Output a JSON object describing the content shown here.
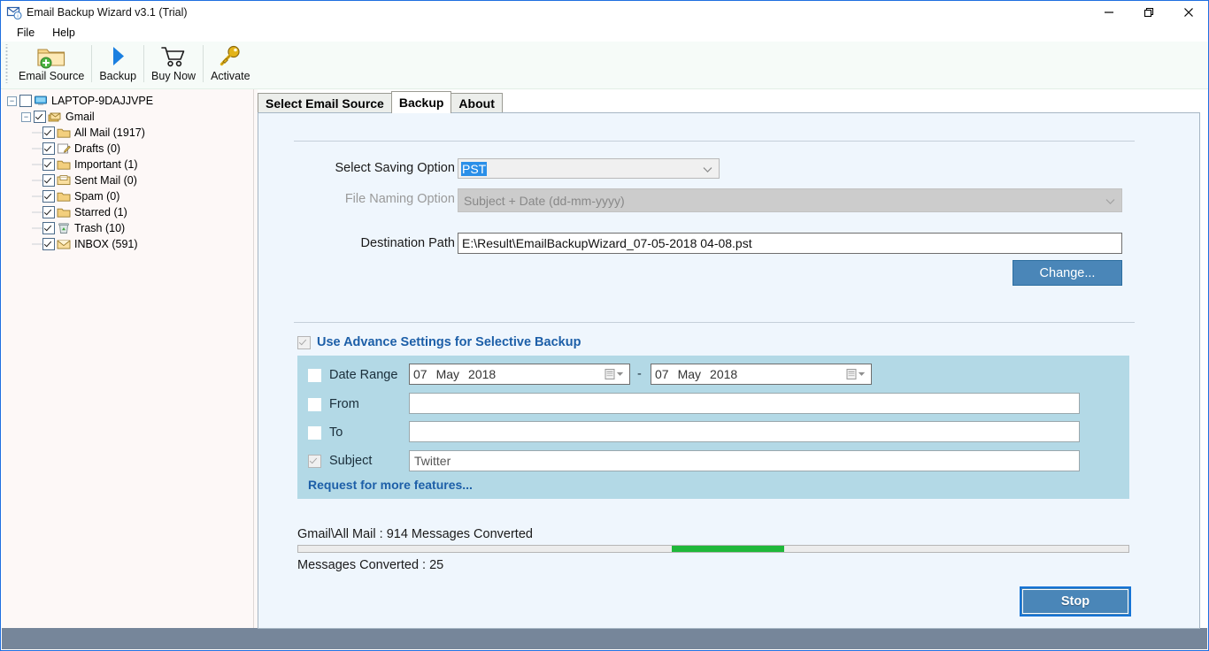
{
  "window": {
    "title": "Email Backup Wizard v3.1 (Trial)",
    "icon": "mail-backup-icon",
    "controls": [
      {
        "name": "minimize-button",
        "glyph": "minimize-icon"
      },
      {
        "name": "maximize-button",
        "glyph": "maximize-icon"
      },
      {
        "name": "close-button",
        "glyph": "close-icon"
      }
    ]
  },
  "menubar": {
    "items": [
      {
        "label": "File",
        "name": "menu-file"
      },
      {
        "label": "Help",
        "name": "menu-help"
      }
    ]
  },
  "toolbar": {
    "buttons": [
      {
        "label": "Email Source",
        "icon": "folder-add-icon",
        "name": "toolbar-email-source"
      },
      {
        "label": "Backup",
        "icon": "play-triangle-icon",
        "name": "toolbar-backup"
      },
      {
        "label": "Buy Now",
        "icon": "shopping-cart-icon",
        "name": "toolbar-buy-now"
      },
      {
        "label": "Activate",
        "icon": "key-icon",
        "name": "toolbar-activate"
      }
    ]
  },
  "tree": {
    "root": {
      "label": "LAPTOP-9DAJJVPE",
      "icon": "computer-icon",
      "checked": false,
      "expanded": true
    },
    "account": {
      "label": "Gmail",
      "icon": "mail-stack-icon",
      "checked": true,
      "expanded": true
    },
    "folders": [
      {
        "label": "All Mail (1917)",
        "icon": "folder-icon",
        "checked": true
      },
      {
        "label": "Drafts (0)",
        "icon": "drafts-icon",
        "checked": true
      },
      {
        "label": "Important (1)",
        "icon": "folder-icon",
        "checked": true
      },
      {
        "label": "Sent Mail (0)",
        "icon": "sent-icon",
        "checked": true
      },
      {
        "label": "Spam (0)",
        "icon": "folder-icon",
        "checked": true
      },
      {
        "label": "Starred (1)",
        "icon": "folder-icon",
        "checked": true
      },
      {
        "label": "Trash (10)",
        "icon": "trash-icon",
        "checked": true
      },
      {
        "label": "INBOX (591)",
        "icon": "inbox-icon",
        "checked": true
      }
    ]
  },
  "tabs": [
    {
      "label": "Select Email Source",
      "name": "tab-select-email-source",
      "active": false
    },
    {
      "label": "Backup",
      "name": "tab-backup",
      "active": true
    },
    {
      "label": "About",
      "name": "tab-about",
      "active": false
    }
  ],
  "form": {
    "saving_option_label": "Select Saving Option :",
    "saving_option_value": "PST",
    "file_naming_label": "File Naming Option :",
    "file_naming_value": "Subject + Date (dd-mm-yyyy)",
    "destination_label": "Destination Path :",
    "destination_value": "E:\\Result\\EmailBackupWizard_07-05-2018 04-08.pst",
    "change_button": "Change..."
  },
  "advance": {
    "title": "Use Advance Settings for Selective Backup",
    "title_checked": true,
    "date_range_label": "Date Range",
    "date_range_checked": false,
    "date_from": {
      "day": "07",
      "month": "May",
      "year": "2018"
    },
    "date_separator": "-",
    "date_to": {
      "day": "07",
      "month": "May",
      "year": "2018"
    },
    "from_label": "From",
    "from_checked": false,
    "from_value": "",
    "to_label": "To",
    "to_checked": false,
    "to_value": "",
    "subject_label": "Subject",
    "subject_checked": true,
    "subject_value": "Twitter",
    "request_link": "Request for more features..."
  },
  "progress": {
    "current_line": "Gmail\\All Mail : 914 Messages Converted",
    "converted_line": "Messages Converted : 25",
    "bar_start_pct": 45,
    "bar_width_pct": 13.5,
    "bar_color": "#1fb83a",
    "stop_button": "Stop"
  },
  "colors": {
    "accent_blue": "#4a86b8",
    "panel_blue": "#eff6fd",
    "advance_panel": "#b3d9e6",
    "link_blue": "#1d5fa8",
    "statusbar": "#76869a"
  }
}
